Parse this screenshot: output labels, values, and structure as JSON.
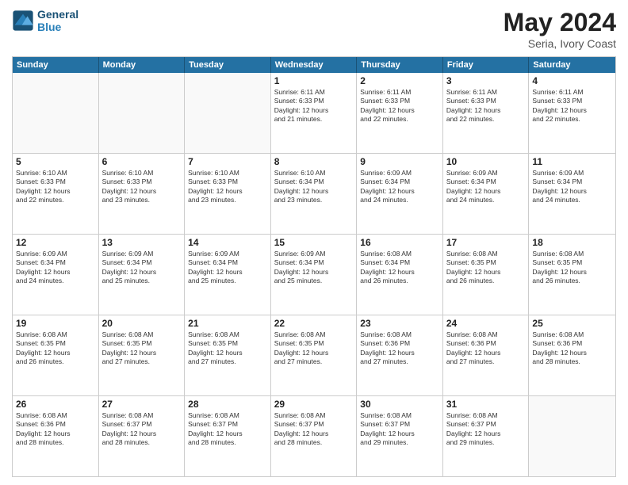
{
  "logo": {
    "line1": "General",
    "line2": "Blue"
  },
  "title": "May 2024",
  "subtitle": "Seria, Ivory Coast",
  "header_days": [
    "Sunday",
    "Monday",
    "Tuesday",
    "Wednesday",
    "Thursday",
    "Friday",
    "Saturday"
  ],
  "rows": [
    [
      {
        "day": "",
        "info": ""
      },
      {
        "day": "",
        "info": ""
      },
      {
        "day": "",
        "info": ""
      },
      {
        "day": "1",
        "info": "Sunrise: 6:11 AM\nSunset: 6:33 PM\nDaylight: 12 hours\nand 21 minutes."
      },
      {
        "day": "2",
        "info": "Sunrise: 6:11 AM\nSunset: 6:33 PM\nDaylight: 12 hours\nand 22 minutes."
      },
      {
        "day": "3",
        "info": "Sunrise: 6:11 AM\nSunset: 6:33 PM\nDaylight: 12 hours\nand 22 minutes."
      },
      {
        "day": "4",
        "info": "Sunrise: 6:11 AM\nSunset: 6:33 PM\nDaylight: 12 hours\nand 22 minutes."
      }
    ],
    [
      {
        "day": "5",
        "info": "Sunrise: 6:10 AM\nSunset: 6:33 PM\nDaylight: 12 hours\nand 22 minutes."
      },
      {
        "day": "6",
        "info": "Sunrise: 6:10 AM\nSunset: 6:33 PM\nDaylight: 12 hours\nand 23 minutes."
      },
      {
        "day": "7",
        "info": "Sunrise: 6:10 AM\nSunset: 6:33 PM\nDaylight: 12 hours\nand 23 minutes."
      },
      {
        "day": "8",
        "info": "Sunrise: 6:10 AM\nSunset: 6:34 PM\nDaylight: 12 hours\nand 23 minutes."
      },
      {
        "day": "9",
        "info": "Sunrise: 6:09 AM\nSunset: 6:34 PM\nDaylight: 12 hours\nand 24 minutes."
      },
      {
        "day": "10",
        "info": "Sunrise: 6:09 AM\nSunset: 6:34 PM\nDaylight: 12 hours\nand 24 minutes."
      },
      {
        "day": "11",
        "info": "Sunrise: 6:09 AM\nSunset: 6:34 PM\nDaylight: 12 hours\nand 24 minutes."
      }
    ],
    [
      {
        "day": "12",
        "info": "Sunrise: 6:09 AM\nSunset: 6:34 PM\nDaylight: 12 hours\nand 24 minutes."
      },
      {
        "day": "13",
        "info": "Sunrise: 6:09 AM\nSunset: 6:34 PM\nDaylight: 12 hours\nand 25 minutes."
      },
      {
        "day": "14",
        "info": "Sunrise: 6:09 AM\nSunset: 6:34 PM\nDaylight: 12 hours\nand 25 minutes."
      },
      {
        "day": "15",
        "info": "Sunrise: 6:09 AM\nSunset: 6:34 PM\nDaylight: 12 hours\nand 25 minutes."
      },
      {
        "day": "16",
        "info": "Sunrise: 6:08 AM\nSunset: 6:34 PM\nDaylight: 12 hours\nand 26 minutes."
      },
      {
        "day": "17",
        "info": "Sunrise: 6:08 AM\nSunset: 6:35 PM\nDaylight: 12 hours\nand 26 minutes."
      },
      {
        "day": "18",
        "info": "Sunrise: 6:08 AM\nSunset: 6:35 PM\nDaylight: 12 hours\nand 26 minutes."
      }
    ],
    [
      {
        "day": "19",
        "info": "Sunrise: 6:08 AM\nSunset: 6:35 PM\nDaylight: 12 hours\nand 26 minutes."
      },
      {
        "day": "20",
        "info": "Sunrise: 6:08 AM\nSunset: 6:35 PM\nDaylight: 12 hours\nand 27 minutes."
      },
      {
        "day": "21",
        "info": "Sunrise: 6:08 AM\nSunset: 6:35 PM\nDaylight: 12 hours\nand 27 minutes."
      },
      {
        "day": "22",
        "info": "Sunrise: 6:08 AM\nSunset: 6:35 PM\nDaylight: 12 hours\nand 27 minutes."
      },
      {
        "day": "23",
        "info": "Sunrise: 6:08 AM\nSunset: 6:36 PM\nDaylight: 12 hours\nand 27 minutes."
      },
      {
        "day": "24",
        "info": "Sunrise: 6:08 AM\nSunset: 6:36 PM\nDaylight: 12 hours\nand 27 minutes."
      },
      {
        "day": "25",
        "info": "Sunrise: 6:08 AM\nSunset: 6:36 PM\nDaylight: 12 hours\nand 28 minutes."
      }
    ],
    [
      {
        "day": "26",
        "info": "Sunrise: 6:08 AM\nSunset: 6:36 PM\nDaylight: 12 hours\nand 28 minutes."
      },
      {
        "day": "27",
        "info": "Sunrise: 6:08 AM\nSunset: 6:37 PM\nDaylight: 12 hours\nand 28 minutes."
      },
      {
        "day": "28",
        "info": "Sunrise: 6:08 AM\nSunset: 6:37 PM\nDaylight: 12 hours\nand 28 minutes."
      },
      {
        "day": "29",
        "info": "Sunrise: 6:08 AM\nSunset: 6:37 PM\nDaylight: 12 hours\nand 28 minutes."
      },
      {
        "day": "30",
        "info": "Sunrise: 6:08 AM\nSunset: 6:37 PM\nDaylight: 12 hours\nand 29 minutes."
      },
      {
        "day": "31",
        "info": "Sunrise: 6:08 AM\nSunset: 6:37 PM\nDaylight: 12 hours\nand 29 minutes."
      },
      {
        "day": "",
        "info": ""
      }
    ]
  ]
}
